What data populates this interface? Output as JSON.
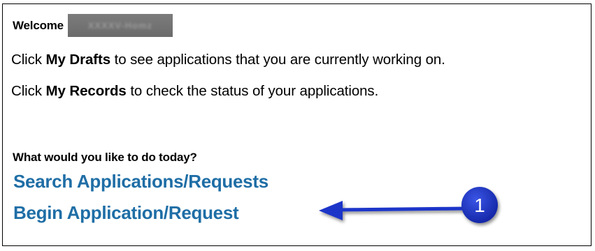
{
  "welcome": {
    "label": "Welcome",
    "username_redacted": "XXXXV-Homz"
  },
  "instructions": [
    {
      "prefix": "Click ",
      "bold": "My Drafts",
      "suffix": " to see applications that you are currently working on."
    },
    {
      "prefix": "Click ",
      "bold": "My Records",
      "suffix": " to check the status of your applications."
    }
  ],
  "question": "What would you like to do today?",
  "links": {
    "search": "Search Applications/Requests",
    "begin": "Begin Application/Request"
  },
  "callout": {
    "number": "1",
    "color": "#1d35c9"
  },
  "colors": {
    "link": "#1f6ea6"
  }
}
